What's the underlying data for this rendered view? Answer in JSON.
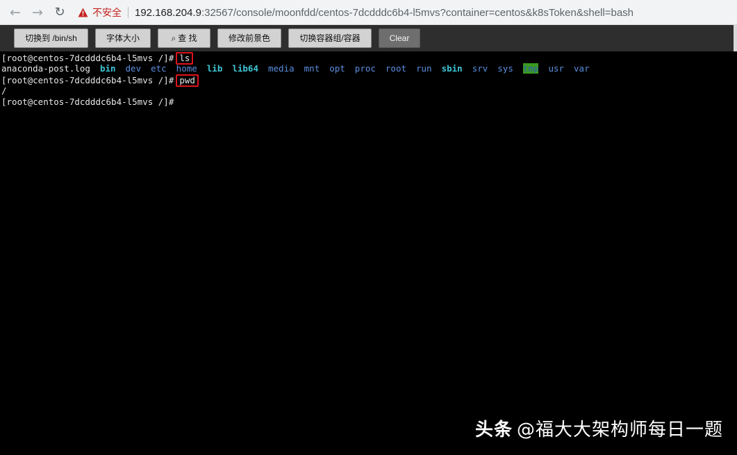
{
  "browser": {
    "back_icon": "back-arrow-icon",
    "forward_icon": "forward-arrow-icon",
    "reload_icon": "reload-icon",
    "security_label": "不安全",
    "url_host": "192.168.204.9",
    "url_rest": ":32567/console/moonfdd/centos-7dcdddc6b4-l5mvs?container=centos&k8sToken&shell=bash"
  },
  "toolbar": {
    "buttons": [
      {
        "label": "切换到 /bin/sh"
      },
      {
        "label": "字体大小"
      },
      {
        "label": "查 找",
        "icon": "search-icon"
      },
      {
        "label": "修改前景色"
      },
      {
        "label": "切换容器组/容器"
      },
      {
        "label": "Clear"
      }
    ]
  },
  "terminal": {
    "prompt": "[root@centos-7dcdddc6b4-l5mvs /]#",
    "commands": [
      "ls",
      "pwd"
    ],
    "ls_output": [
      {
        "name": "anaconda-post.log",
        "type": "file"
      },
      {
        "name": "bin",
        "type": "link"
      },
      {
        "name": "dev",
        "type": "dir"
      },
      {
        "name": "etc",
        "type": "dir"
      },
      {
        "name": "home",
        "type": "dir"
      },
      {
        "name": "lib",
        "type": "link"
      },
      {
        "name": "lib64",
        "type": "link"
      },
      {
        "name": "media",
        "type": "dir"
      },
      {
        "name": "mnt",
        "type": "dir"
      },
      {
        "name": "opt",
        "type": "dir"
      },
      {
        "name": "proc",
        "type": "dir"
      },
      {
        "name": "root",
        "type": "dir"
      },
      {
        "name": "run",
        "type": "dir"
      },
      {
        "name": "sbin",
        "type": "link"
      },
      {
        "name": "srv",
        "type": "dir"
      },
      {
        "name": "sys",
        "type": "dir"
      },
      {
        "name": "tmp",
        "type": "tmp"
      },
      {
        "name": "usr",
        "type": "dir"
      },
      {
        "name": "var",
        "type": "dir"
      }
    ],
    "pwd_output": "/"
  },
  "watermark": {
    "brand": "头条",
    "handle": "@福大大架构师每日一题"
  },
  "colors": {
    "highlight_box": "#e0141c",
    "dir": "#5b8fe0",
    "link": "#3fc6d6",
    "tmp_bg": "#3a9a1f"
  }
}
